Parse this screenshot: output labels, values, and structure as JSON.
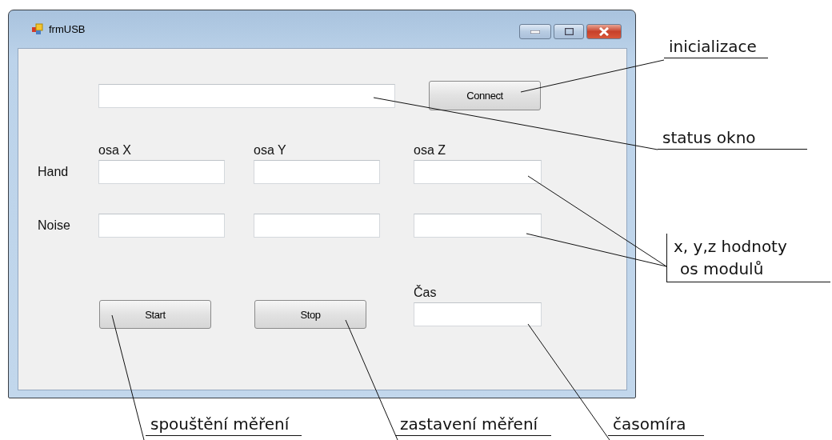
{
  "window": {
    "title": "frmUSB"
  },
  "connect_button": "Connect",
  "axis_labels": [
    "osa X",
    "osa Y",
    "osa Z"
  ],
  "rows": [
    {
      "label": "Hand"
    },
    {
      "label": "Noise"
    }
  ],
  "buttons": [
    "Start",
    "Stop"
  ],
  "time": {
    "label": "Čas"
  },
  "annotations": [
    {
      "kind": "underlined",
      "lines": [
        "inicializace"
      ]
    },
    {
      "kind": "underlined",
      "lines": [
        "status okno"
      ]
    },
    {
      "kind": "bracketed",
      "lines": [
        "x, y,z hodnoty",
        "os modulů"
      ]
    },
    {
      "kind": "underlined",
      "lines": [
        "spouštění měření"
      ]
    },
    {
      "kind": "underlined",
      "lines": [
        "zastavení měření"
      ]
    },
    {
      "kind": "underlined",
      "lines": [
        "časomíra"
      ]
    }
  ]
}
